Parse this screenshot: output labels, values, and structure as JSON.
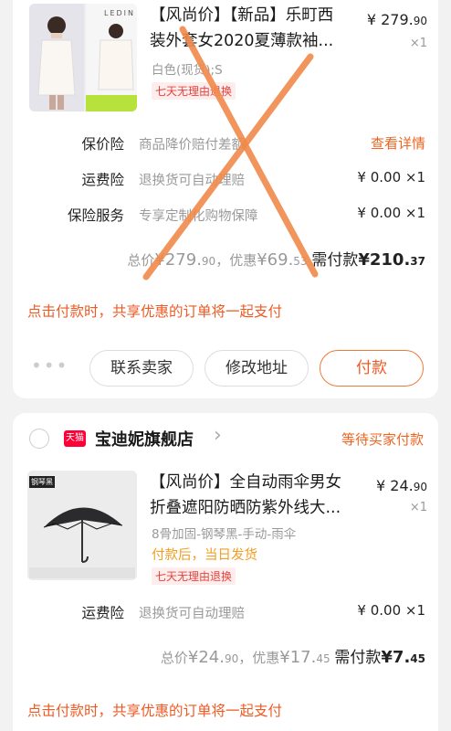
{
  "order1": {
    "product": {
      "title_line1": "【风尚价】【新品】乐町西",
      "title_line2": "装外套女2020夏薄款袖...",
      "thumb_brand": "LEDIN",
      "sku": "白色(现货);S",
      "badge": "七天无理由退换",
      "price_main": "¥ 279.",
      "price_dec": "90",
      "qty": "×1"
    },
    "rows": [
      {
        "label": "保价险",
        "desc": "商品降价赔付差额",
        "value": "查看详情",
        "value_is_link": true
      },
      {
        "label": "运费险",
        "desc": "退换货可自动理赔",
        "value": "¥ 0.00 ×1",
        "value_is_link": false
      },
      {
        "label": "保险服务",
        "desc": "专享定制化购物保障",
        "value": "¥ 0.00 ×1",
        "value_is_link": false
      }
    ],
    "total": {
      "total_label": "总价",
      "total_main": "¥279.",
      "total_dec": "90",
      "discount_label": "，优惠",
      "discount_main": "¥69.",
      "discount_dec": "53",
      "need_label": "需付款",
      "need_main": "¥210.",
      "need_dec": "37"
    },
    "notice": "点击付款时，共享优惠的订单将一起支付",
    "more": "•••",
    "buttons": {
      "contact": "联系卖家",
      "modify": "修改地址",
      "pay": "付款"
    }
  },
  "order2": {
    "shop_badge": "天猫",
    "shop_name": "宝迪妮旗舰店",
    "shop_chevron": "›",
    "status": "等待买家付款",
    "product": {
      "title_line1": "【风尚价】全自动雨伞男女",
      "title_line2": "折叠遮阳防晒防紫外线大...",
      "thumb_tag": "钢琴黑",
      "sku": "8骨加固-钢琴黑-手动-雨伞",
      "shipping": "付款后，当日发货",
      "badge": "七天无理由退换",
      "price_main": "¥ 24.",
      "price_dec": "90",
      "qty": "×1"
    },
    "rows": [
      {
        "label": "运费险",
        "desc": "退换货可自动理赔",
        "value": "¥ 0.00 ×1"
      }
    ],
    "total": {
      "total_label": "总价",
      "total_main": "¥24.",
      "total_dec": "90",
      "discount_label": "，优惠",
      "discount_main": "¥17.",
      "discount_dec": "45",
      "need_label": "需付款",
      "need_main": "¥7.",
      "need_dec": "45"
    },
    "notice": "点击付款时，共享优惠的订单将一起支付"
  },
  "colors": {
    "accent": "#ee5a24",
    "tmall": "#ff0036",
    "x_mark": "#f08a4b"
  }
}
